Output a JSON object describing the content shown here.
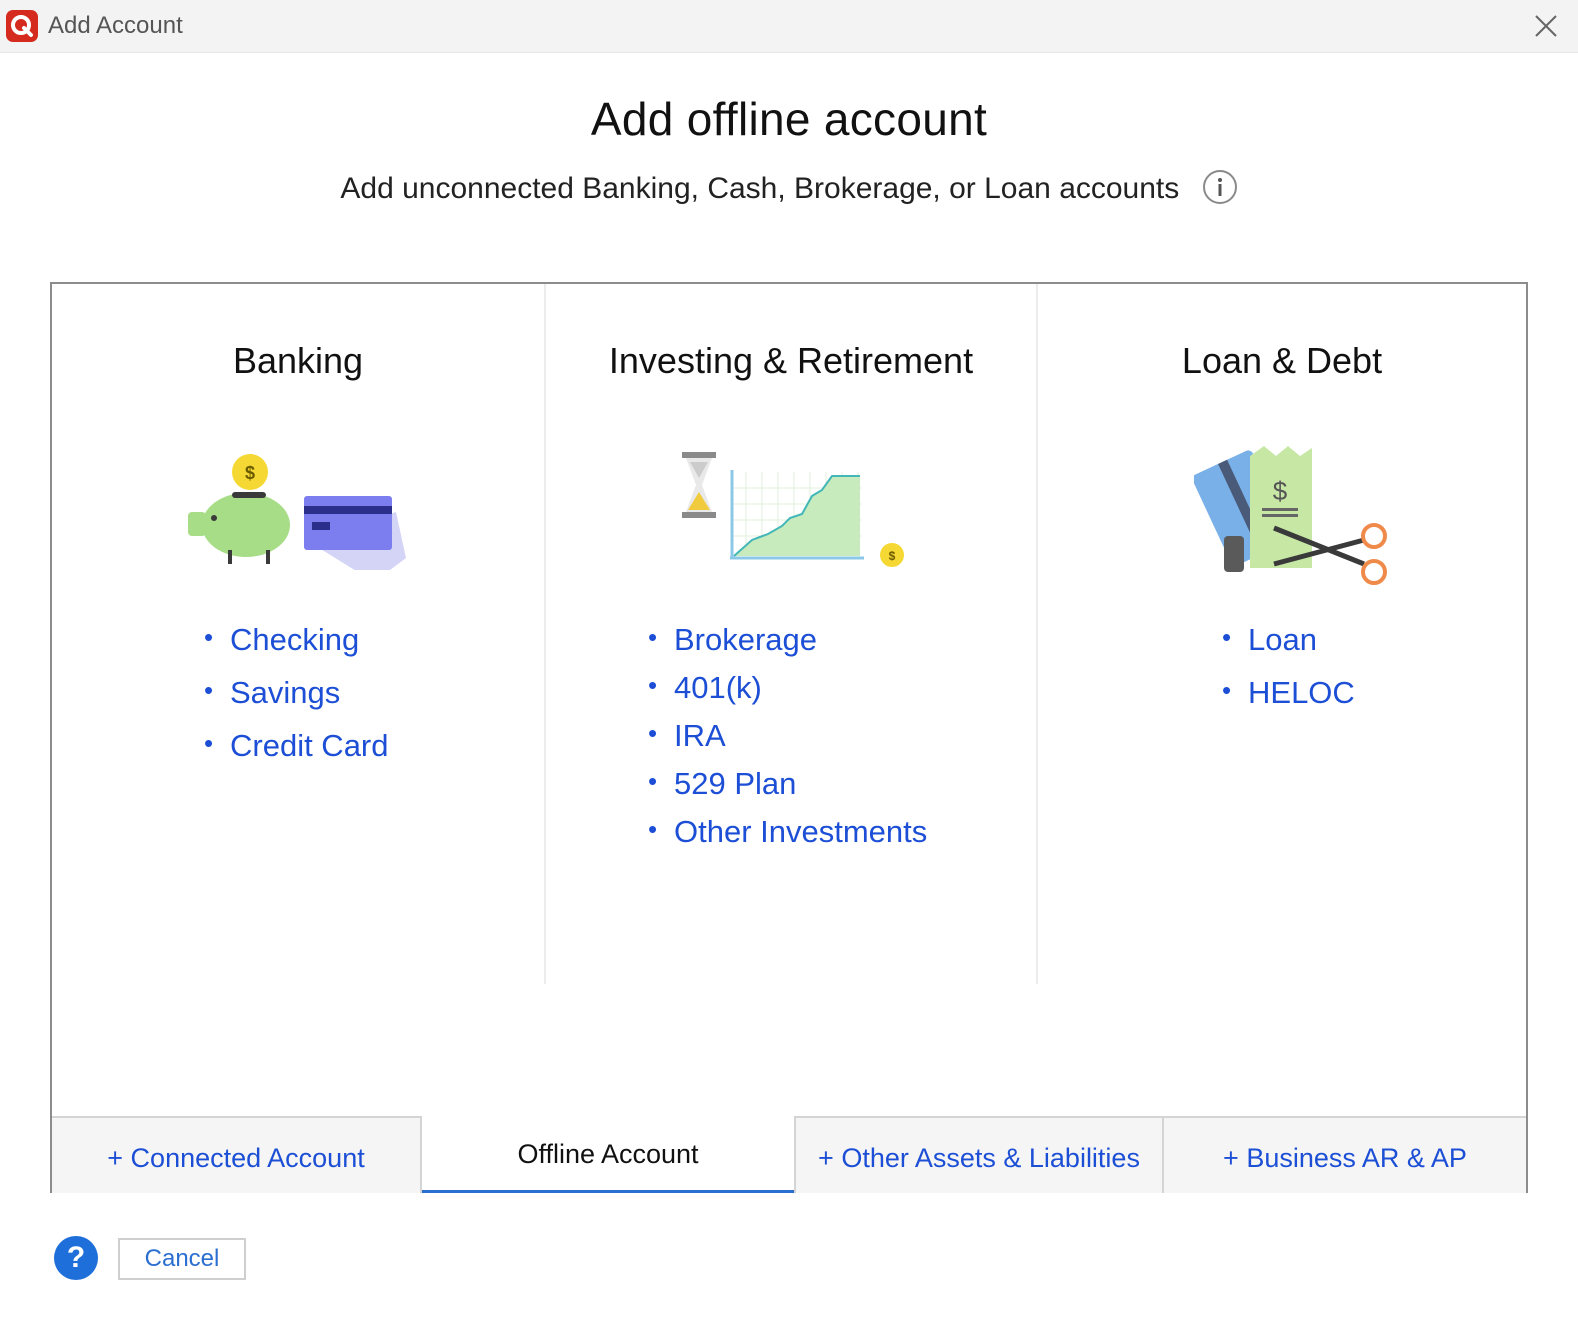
{
  "window": {
    "title": "Add Account",
    "logo_icon": "quicken-logo-icon",
    "close_icon": "close-icon"
  },
  "header": {
    "title": "Add offline account",
    "subtitle": "Add unconnected Banking, Cash, Brokerage, or Loan accounts",
    "info_icon": "info-icon"
  },
  "categories": [
    {
      "title": "Banking",
      "illustration": "piggy-bank-credit-card-illustration",
      "items": [
        "Checking",
        "Savings",
        "Credit Card"
      ]
    },
    {
      "title": "Investing & Retirement",
      "illustration": "hourglass-growth-chart-illustration",
      "items": [
        "Brokerage",
        "401(k)",
        "IRA",
        "529 Plan",
        "Other Investments"
      ]
    },
    {
      "title": "Loan & Debt",
      "illustration": "bill-card-scissors-illustration",
      "items": [
        "Loan",
        "HELOC"
      ]
    }
  ],
  "tabs": [
    {
      "label": "+ Connected Account",
      "selected": false
    },
    {
      "label": "Offline Account",
      "selected": true
    },
    {
      "label": "+ Other Assets & Liabilities",
      "selected": false
    },
    {
      "label": "+ Business AR & AP",
      "selected": false
    }
  ],
  "footer": {
    "help_label": "?",
    "cancel_label": "Cancel"
  },
  "colors": {
    "link": "#1c4fd6",
    "accent": "#2a6fd0",
    "brand": "#d52b1e",
    "tab_inactive_bg": "#f5f5f5"
  }
}
